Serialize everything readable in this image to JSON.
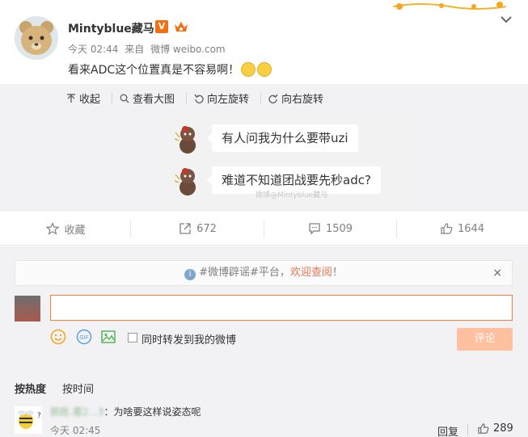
{
  "post": {
    "username": "Mintyblue藏马",
    "verified_badge": "V",
    "time": "今天 02:44",
    "source_prefix": "来自",
    "source": "微博 weibo.com",
    "text": "看来ADC这个位置真是不容易啊！"
  },
  "media_toolbar": {
    "collapse": "收起",
    "view_large": "查看大图",
    "rotate_left": "向左旋转",
    "rotate_right": "向右旋转"
  },
  "image": {
    "messages": [
      "有人问我为什么要带uzi",
      "难道不知道团战要先秒adc?"
    ],
    "watermark": "微博@Mintyblue藏马"
  },
  "actions": {
    "favorite": "收藏",
    "repost_count": "672",
    "comment_count": "1509",
    "like_count": "1644"
  },
  "notice": {
    "prefix": "#微博辟谣#平台，",
    "link": "欢迎查阅",
    "suffix": "！",
    "close": "×"
  },
  "composer": {
    "input_value": "",
    "repost_checkbox_label": "同时转发到我的微博",
    "submit_label": "评论"
  },
  "sort": {
    "by_hot": "按热度",
    "by_time": "按时间"
  },
  "comments": [
    {
      "username": "鹅胜.覆2...3",
      "text": "：为啥要这样说姿态呢",
      "time": "今天 02:45",
      "reply_label": "回复",
      "likes": "289"
    }
  ],
  "colors": {
    "accent": "#fa7d3c",
    "link": "#eb7350",
    "submit_disabled": "#ffc09f",
    "panel_bg": "#f2f2f5"
  }
}
